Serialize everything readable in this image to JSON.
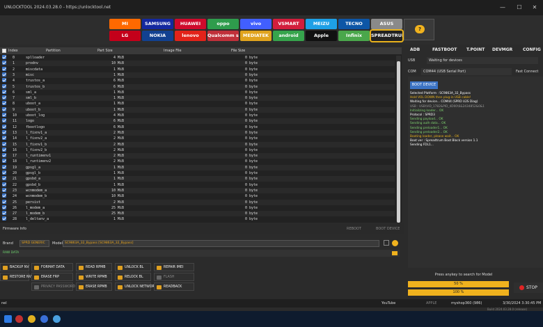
{
  "window": {
    "title": "UNLOCKTOOL 2024.03.28.0 - https://unlocktool.net",
    "minimize": "—",
    "maximize": "☐",
    "close": "✕"
  },
  "brands": [
    {
      "label": "MI",
      "color": "#ff6900"
    },
    {
      "label": "SAMSUNG",
      "color": "#1428a0"
    },
    {
      "label": "HUAWEI",
      "color": "#cf0a2c"
    },
    {
      "label": "oppo",
      "color": "#2e9c4c"
    },
    {
      "label": "vivo",
      "color": "#415fff"
    },
    {
      "label": "VSMART",
      "color": "#d21e3c"
    },
    {
      "label": "MEIZU",
      "color": "#1ea0e6"
    },
    {
      "label": "TECNO",
      "color": "#0d56a6"
    },
    {
      "label": "ASUS",
      "color": "#8a8a8a"
    },
    {
      "label": "LG",
      "color": "#c4001a"
    },
    {
      "label": "NOKIA",
      "color": "#124191"
    },
    {
      "label": "lenovo",
      "color": "#e2231a"
    },
    {
      "label": "Qualcomm snapdragon",
      "color": "#c0303a"
    },
    {
      "label": "MEDIATEK",
      "color": "#e0a31e"
    },
    {
      "label": "android",
      "color": "#36a44c"
    },
    {
      "label": "Apple",
      "color": "#111111"
    },
    {
      "label": "Infinix",
      "color": "#4aa74b"
    },
    {
      "label": "SPREADTRUM",
      "color": "#222222",
      "selected": true
    }
  ],
  "help_icon": "?",
  "toolbar": {
    "adb": "ADB",
    "fastboot": "FASTBOOT",
    "tpoint": "T.POINT",
    "devmgr": "DEVMGR",
    "config": "CONFIG"
  },
  "table": {
    "headers": {
      "index": "Index",
      "partition": "Partition",
      "size": "Part Size",
      "image": "Image File",
      "file_size": "File Size"
    },
    "rows": [
      {
        "i": "0",
        "p": "splloader",
        "s": "4 MiB",
        "f": "0 byte"
      },
      {
        "i": "1",
        "p": "prodnv",
        "s": "10 MiB",
        "f": "0 byte"
      },
      {
        "i": "2",
        "p": "miscdata",
        "s": "1 MiB",
        "f": "0 byte"
      },
      {
        "i": "3",
        "p": "misc",
        "s": "1 MiB",
        "f": "0 byte"
      },
      {
        "i": "4",
        "p": "trustos_a",
        "s": "6 MiB",
        "f": "0 byte"
      },
      {
        "i": "5",
        "p": "trustos_b",
        "s": "6 MiB",
        "f": "0 byte"
      },
      {
        "i": "6",
        "p": "sml_a",
        "s": "1 MiB",
        "f": "0 byte"
      },
      {
        "i": "7",
        "p": "sml_b",
        "s": "1 MiB",
        "f": "0 byte"
      },
      {
        "i": "8",
        "p": "uboot_a",
        "s": "1 MiB",
        "f": "0 byte"
      },
      {
        "i": "9",
        "p": "uboot_b",
        "s": "1 MiB",
        "f": "0 byte"
      },
      {
        "i": "10",
        "p": "uboot_log",
        "s": "4 MiB",
        "f": "0 byte"
      },
      {
        "i": "11",
        "p": "logo",
        "s": "6 MiB",
        "f": "0 byte"
      },
      {
        "i": "12",
        "p": "fbootlogo",
        "s": "6 MiB",
        "f": "0 byte"
      },
      {
        "i": "13",
        "p": "l_fixnv1_a",
        "s": "2 MiB",
        "f": "0 byte"
      },
      {
        "i": "14",
        "p": "l_fixnv2_a",
        "s": "2 MiB",
        "f": "0 byte"
      },
      {
        "i": "15",
        "p": "l_fixnv1_b",
        "s": "2 MiB",
        "f": "0 byte"
      },
      {
        "i": "16",
        "p": "l_fixnv2_b",
        "s": "2 MiB",
        "f": "0 byte"
      },
      {
        "i": "17",
        "p": "l_runtimenv1",
        "s": "2 MiB",
        "f": "0 byte"
      },
      {
        "i": "18",
        "p": "l_runtimenv2",
        "s": "2 MiB",
        "f": "0 byte"
      },
      {
        "i": "19",
        "p": "gpsgl_a",
        "s": "1 MiB",
        "f": "0 byte"
      },
      {
        "i": "20",
        "p": "gpsgl_b",
        "s": "1 MiB",
        "f": "0 byte"
      },
      {
        "i": "21",
        "p": "gpsbd_a",
        "s": "1 MiB",
        "f": "0 byte"
      },
      {
        "i": "22",
        "p": "gpsbd_b",
        "s": "1 MiB",
        "f": "0 byte"
      },
      {
        "i": "23",
        "p": "wcnmodem_a",
        "s": "10 MiB",
        "f": "0 byte"
      },
      {
        "i": "24",
        "p": "wcnmodem_b",
        "s": "10 MiB",
        "f": "0 byte"
      },
      {
        "i": "25",
        "p": "persist",
        "s": "2 MiB",
        "f": "0 byte"
      },
      {
        "i": "26",
        "p": "l_modem_a",
        "s": "25 MiB",
        "f": "0 byte"
      },
      {
        "i": "27",
        "p": "l_modem_b",
        "s": "25 MiB",
        "f": "0 byte"
      },
      {
        "i": "28",
        "p": "l_deltanv_a",
        "s": "1 MiB",
        "f": "0 byte"
      }
    ]
  },
  "firmware": {
    "label": "Firmware Info",
    "reboot": "REBOOT",
    "boot_device": "BOOT DEVICE"
  },
  "form": {
    "brand_label": "Brand",
    "brand_value": "SPRD GENERIC",
    "model_label": "Model",
    "model_value": "SC9863A_32_Bypass [SC9863A_32_Bypass]",
    "raw_label": "RAW DATA"
  },
  "actions": [
    {
      "label": "BACKUP NV",
      "disabled": false
    },
    {
      "label": "FORMAT DATA",
      "disabled": false
    },
    {
      "label": "READ RPMB",
      "disabled": false
    },
    {
      "label": "UNLOCK BL",
      "disabled": false
    },
    {
      "label": "REPAIR IMEI",
      "disabled": false
    },
    {
      "label": "RESTORE NV",
      "disabled": false
    },
    {
      "label": "ERASE FRP",
      "disabled": false
    },
    {
      "label": "WRITE RPMB",
      "disabled": false
    },
    {
      "label": "RELOCK BL",
      "disabled": false
    },
    {
      "label": "FLASH",
      "disabled": true
    },
    {
      "label": "PRIVACY PASSWORD",
      "disabled": true
    },
    {
      "label": "ERASE RPMB",
      "disabled": false
    },
    {
      "label": "UNLOCK NETWORK",
      "disabled": false
    },
    {
      "label": "READBACK",
      "disabled": false
    }
  ],
  "right": {
    "usb_label": "USB",
    "usb_value": "Waiting for devices",
    "com_label": "COM",
    "com_value": "COM44 (USB Serial Port)",
    "fast_connect": "Fast Connect",
    "boot_device": "BOOT DEVICE",
    "log": [
      {
        "t": "Selected Platform : SC9863A_32_Bypass",
        "c": "#ffffff"
      },
      {
        "t": "Hold VOL DOWN then plug-in USB cable!",
        "c": "#e9b21b"
      },
      {
        "t": "Waiting for device... COM44 (SPRD U2S Diag)",
        "c": "#ffffff"
      },
      {
        "t": "USB : USB\\VID_1782&PID_4D00\\6&2434852&0&1",
        "c": "#9a9a9a"
      },
      {
        "t": "Initializing loader... OK",
        "c": "#7fd36f"
      },
      {
        "t": "Protocol : SPRD3",
        "c": "#ffffff"
      },
      {
        "t": "Sending payload... OK",
        "c": "#7fd36f"
      },
      {
        "t": "Sending auth data... OK",
        "c": "#7fd36f"
      },
      {
        "t": "Sending preloader1... OK",
        "c": "#7fd36f"
      },
      {
        "t": "Sending preloader2... OK",
        "c": "#7fd36f"
      },
      {
        "t": "Booting loader, please wait... OK",
        "c": "#e9b21b"
      },
      {
        "t": "Boot ver : Spreadtrum Boot Block version 1.1",
        "c": "#ffffff"
      },
      {
        "t": "Sending FDL1...",
        "c": "#ffffff"
      }
    ],
    "prompt": "Press anykey to search for Model",
    "progress1": {
      "label": "50 %",
      "value": 0.5
    },
    "progress2": {
      "label": "100 %",
      "value": 1.0
    },
    "stop": "STOP"
  },
  "statusbar": {
    "left": "nel",
    "youtube": "YouTube",
    "apple": "APPLE",
    "user": "myshop360 (986)",
    "datetime": "3/30/2024 3:30:45 PM",
    "build": "Build 2024.03.28.0 (release)"
  },
  "colors": {
    "accent": "#f0b21e",
    "bg": "#2b2b2b",
    "blue": "#3b73c4"
  }
}
